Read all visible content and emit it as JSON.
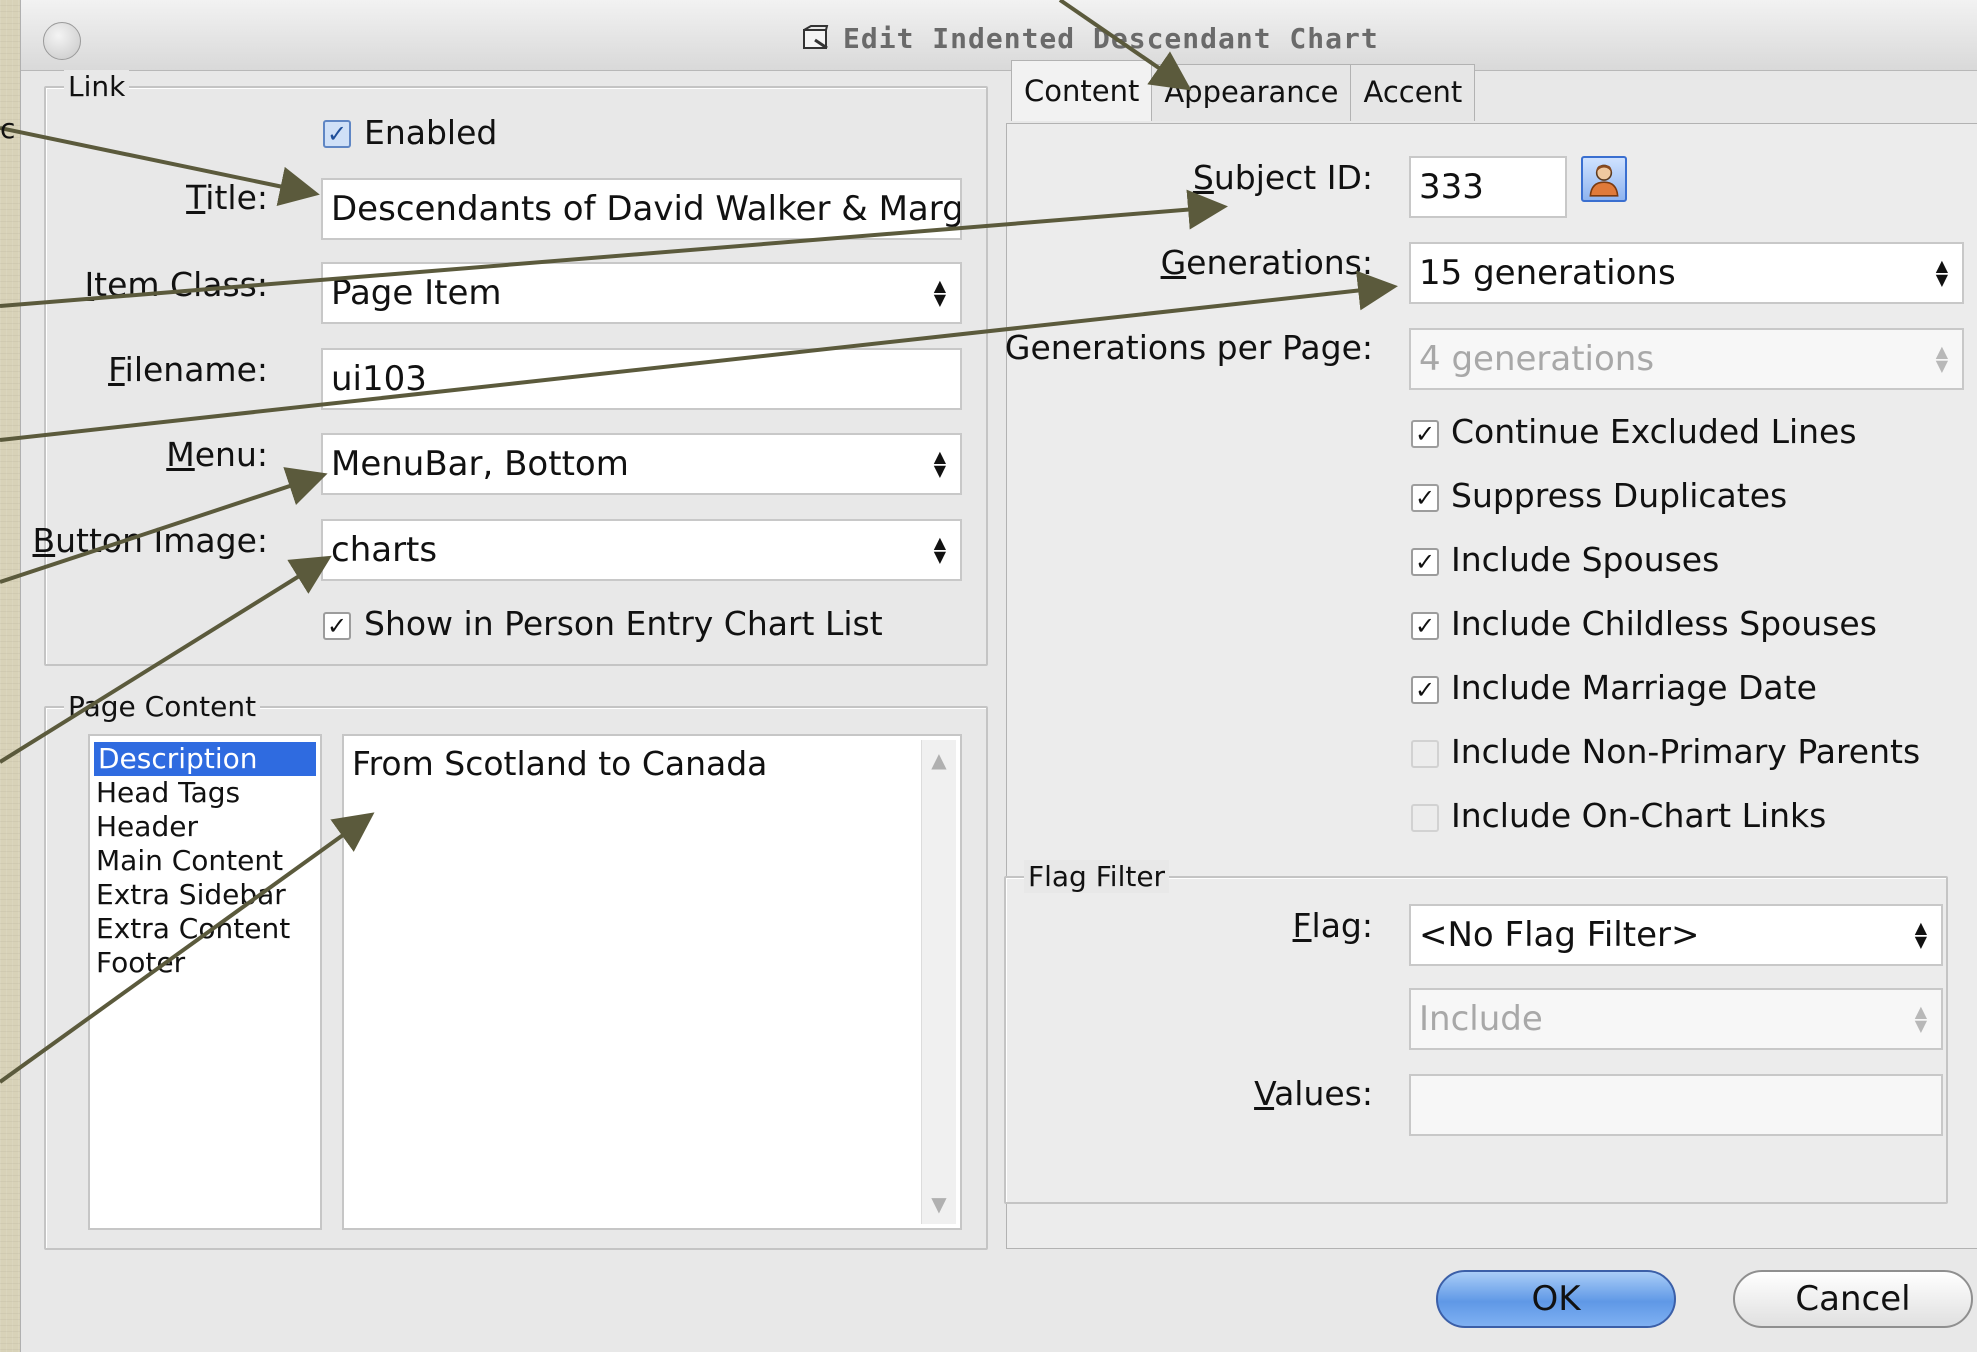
{
  "window": {
    "title": "Edit Indented Descendant Chart"
  },
  "link": {
    "legend": "Link",
    "enabled_label": "Enabled",
    "enabled_checked": true,
    "title_label": "Title:",
    "title_value": "Descendants of David Walker & Marg",
    "item_class_label": "Item Class:",
    "item_class_value": "Page Item",
    "filename_label": "Filename:",
    "filename_value": "ui103",
    "menu_label": "Menu:",
    "menu_value": "MenuBar, Bottom",
    "button_image_label": "Button Image:",
    "button_image_value": "charts",
    "show_in_list_label": "Show in Person Entry Chart List",
    "show_in_list_checked": true
  },
  "page_content": {
    "legend": "Page Content",
    "items": [
      "Description",
      "Head Tags",
      "Header",
      "Main Content",
      "Extra Sidebar",
      "Extra Content",
      "Footer"
    ],
    "selected_index": 0,
    "text": "From Scotland to Canada"
  },
  "tabs": [
    "Content",
    "Appearance",
    "Accent"
  ],
  "content": {
    "subject_id_label": "Subject ID:",
    "subject_id_value": "333",
    "generations_label": "Generations:",
    "generations_value": "15 generations",
    "gens_per_page_label": "Generations per Page:",
    "gens_per_page_value": "4 generations",
    "options": [
      {
        "label": "Continue Excluded Lines",
        "checked": true
      },
      {
        "label": "Suppress Duplicates",
        "checked": true
      },
      {
        "label": "Include Spouses",
        "checked": true
      },
      {
        "label": "Include Childless Spouses",
        "checked": true
      },
      {
        "label": "Include Marriage Date",
        "checked": true
      },
      {
        "label": "Include Non-Primary Parents",
        "checked": false
      },
      {
        "label": "Include On-Chart Links",
        "checked": false
      }
    ]
  },
  "flag_filter": {
    "legend": "Flag Filter",
    "flag_label": "Flag:",
    "flag_value": "<No Flag Filter>",
    "mode_value": "Include",
    "values_label": "Values:",
    "values_value": ""
  },
  "buttons": {
    "ok": "OK",
    "cancel": "Cancel"
  },
  "colors": {
    "accent": "#2f6be0",
    "annotation_arrow": "#5b5a3c"
  }
}
